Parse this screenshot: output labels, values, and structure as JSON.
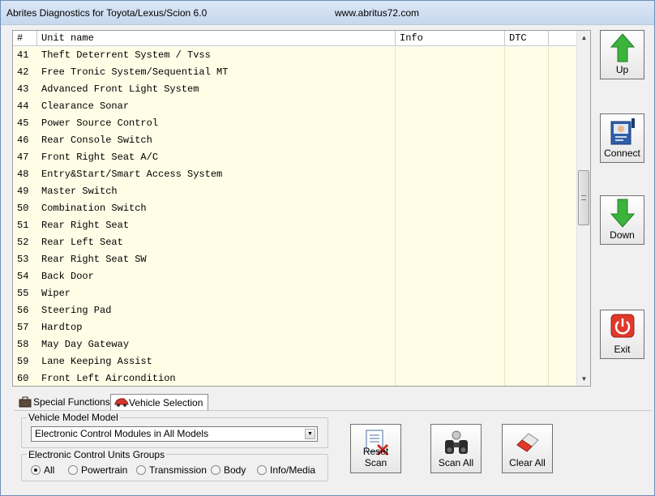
{
  "window": {
    "title": "Abrites Diagnostics for Toyota/Lexus/Scion 6.0",
    "url": "www.abritus72.com"
  },
  "grid": {
    "headers": {
      "num": "#",
      "name": "Unit name",
      "info": "Info",
      "dtc": "DTC"
    },
    "rows": [
      {
        "num": "41",
        "name": "Theft Deterrent System / Tvss",
        "info": "",
        "dtc": ""
      },
      {
        "num": "42",
        "name": "Free Tronic System/Sequential MT",
        "info": "",
        "dtc": ""
      },
      {
        "num": "43",
        "name": "Advanced Front Light System",
        "info": "",
        "dtc": ""
      },
      {
        "num": "44",
        "name": "Clearance Sonar",
        "info": "",
        "dtc": ""
      },
      {
        "num": "45",
        "name": "Power Source Control",
        "info": "",
        "dtc": ""
      },
      {
        "num": "46",
        "name": "Rear Console Switch",
        "info": "",
        "dtc": ""
      },
      {
        "num": "47",
        "name": "Front Right Seat A/C",
        "info": "",
        "dtc": ""
      },
      {
        "num": "48",
        "name": "Entry&Start/Smart Access System",
        "info": "",
        "dtc": ""
      },
      {
        "num": "49",
        "name": "Master Switch",
        "info": "",
        "dtc": ""
      },
      {
        "num": "50",
        "name": "Combination Switch",
        "info": "",
        "dtc": ""
      },
      {
        "num": "51",
        "name": "Rear Right Seat",
        "info": "",
        "dtc": ""
      },
      {
        "num": "52",
        "name": "Rear Left Seat",
        "info": "",
        "dtc": ""
      },
      {
        "num": "53",
        "name": "Rear Right Seat SW",
        "info": "",
        "dtc": ""
      },
      {
        "num": "54",
        "name": "Back Door",
        "info": "",
        "dtc": ""
      },
      {
        "num": "55",
        "name": "Wiper",
        "info": "",
        "dtc": ""
      },
      {
        "num": "56",
        "name": "Steering Pad",
        "info": "",
        "dtc": ""
      },
      {
        "num": "57",
        "name": "Hardtop",
        "info": "",
        "dtc": ""
      },
      {
        "num": "58",
        "name": "May Day Gateway",
        "info": "",
        "dtc": ""
      },
      {
        "num": "59",
        "name": "Lane Keeping Assist",
        "info": "",
        "dtc": ""
      },
      {
        "num": "60",
        "name": "Front Left Aircondition",
        "info": "",
        "dtc": ""
      }
    ]
  },
  "side_buttons": {
    "up": "Up",
    "connect": "Connect",
    "down": "Down",
    "exit": "Exit"
  },
  "tabs": {
    "special": "Special Functions",
    "vehicle": "Vehicle Selection",
    "active": "vehicle"
  },
  "vehicle_model": {
    "legend": "Vehicle Model Model",
    "selected": "Electronic Control Modules in All Models"
  },
  "ecu_groups": {
    "legend": "Electronic Control Units Groups",
    "options": [
      "All",
      "Powertrain",
      "Transmission",
      "Body",
      "Info/Media"
    ],
    "selected": "All"
  },
  "actions": {
    "reset": "Reset Scan",
    "scan_all": "Scan All",
    "clear_all": "Clear All"
  },
  "colors": {
    "grid_bg": "#fffde6",
    "arrow_green": "#3cb43c",
    "exit_red": "#e0392b"
  }
}
